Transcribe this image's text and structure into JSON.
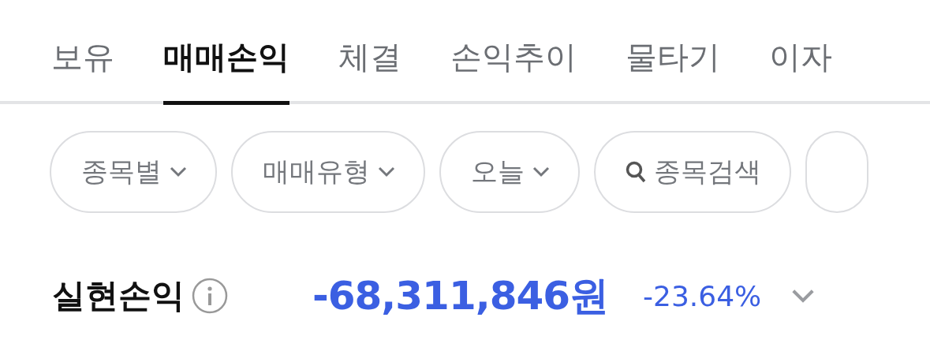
{
  "tabs": [
    {
      "label": "보유",
      "selected": false
    },
    {
      "label": "매매손익",
      "selected": true
    },
    {
      "label": "체결",
      "selected": false
    },
    {
      "label": "손익추이",
      "selected": false
    },
    {
      "label": "물타기",
      "selected": false
    },
    {
      "label": "이자",
      "selected": false
    }
  ],
  "filters": [
    {
      "kind": "dropdown",
      "label": "종목별"
    },
    {
      "kind": "dropdown",
      "label": "매매유형"
    },
    {
      "kind": "dropdown",
      "label": "오늘"
    },
    {
      "kind": "search",
      "label": "종목검색"
    }
  ],
  "summary": {
    "label": "실현손익",
    "amount": "-68,311,846원",
    "rate": "-23.64%",
    "expanded": false
  }
}
